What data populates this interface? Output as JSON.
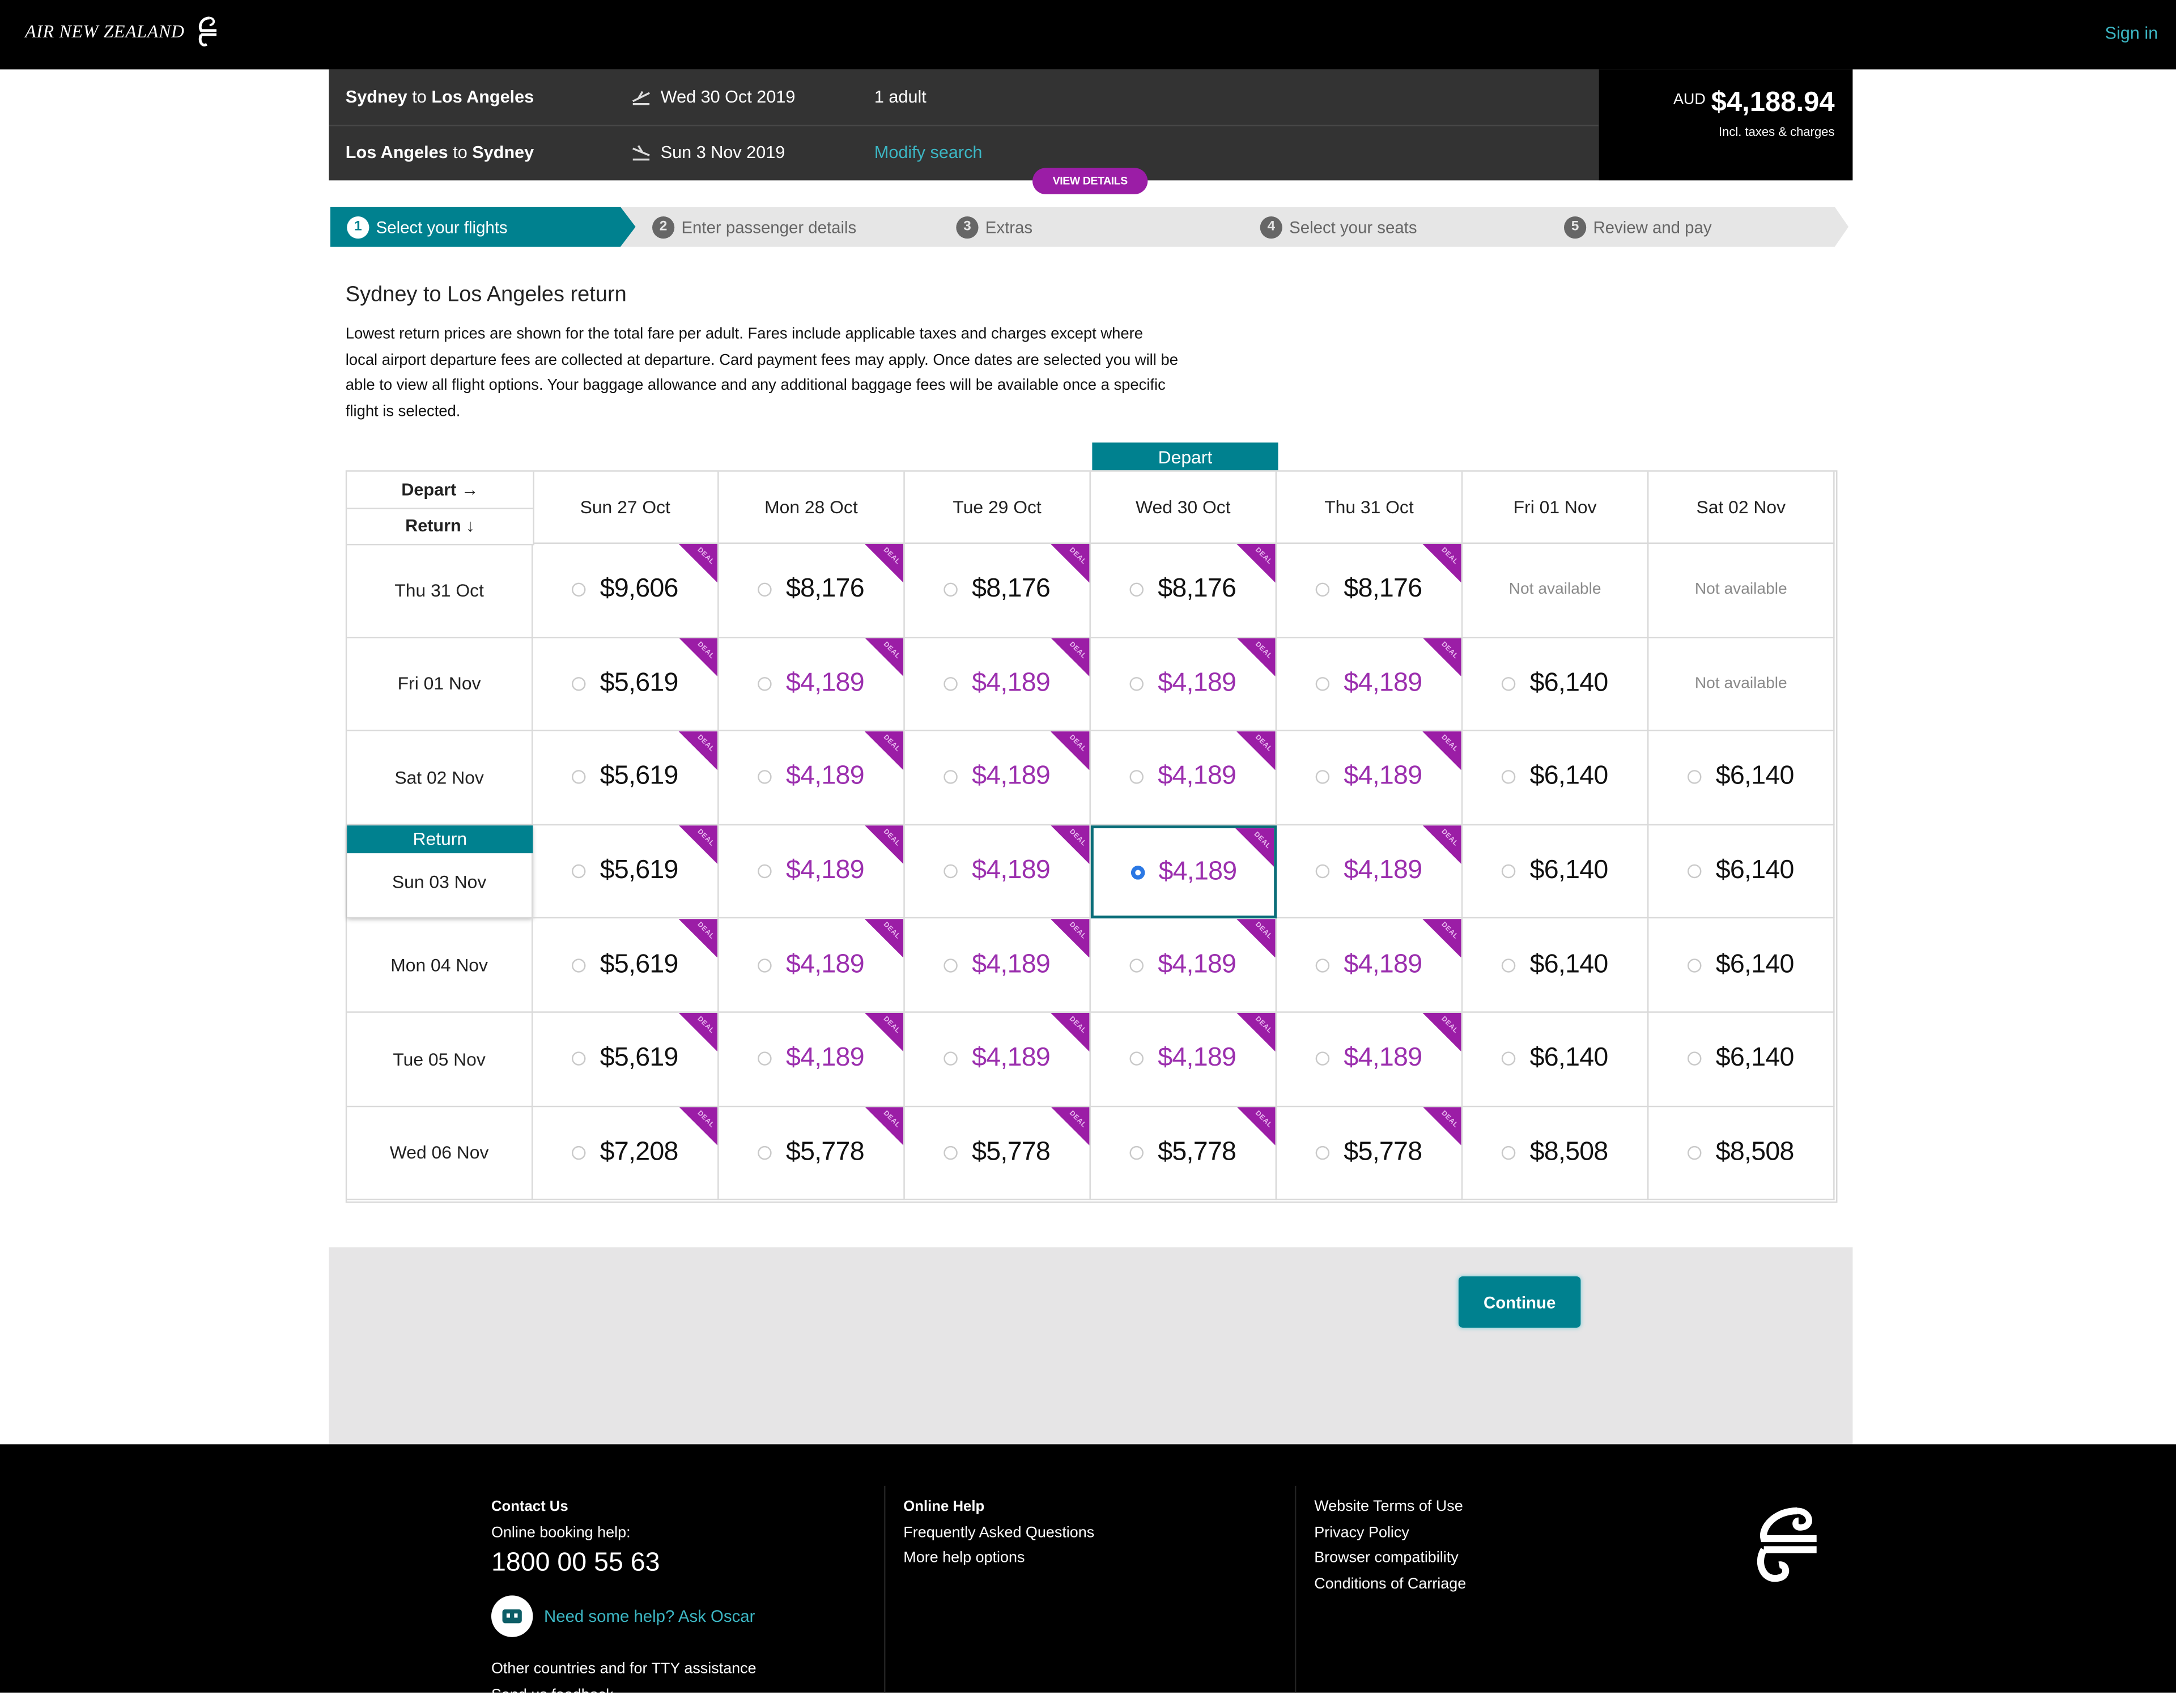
{
  "header": {
    "brand": "AIR NEW ZEALAND",
    "sign_in": "Sign in"
  },
  "summary": {
    "outbound": {
      "from": "Sydney",
      "to_word": "to",
      "to": "Los Angeles",
      "date": "Wed 30 Oct 2019",
      "icon": "plane-takeoff-icon"
    },
    "inbound": {
      "from": "Los Angeles",
      "to_word": "to",
      "to": "Sydney",
      "date": "Sun 3 Nov 2019",
      "icon": "plane-landing-icon"
    },
    "passengers": "1 adult",
    "modify_search": "Modify search",
    "view_details": "VIEW DETAILS",
    "currency": "AUD",
    "total": "$4,188.94",
    "total_note": "Incl. taxes & charges"
  },
  "steps": [
    {
      "num": "1",
      "label": "Select your flights",
      "active": true
    },
    {
      "num": "2",
      "label": "Enter passenger details",
      "active": false
    },
    {
      "num": "3",
      "label": "Extras",
      "active": false
    },
    {
      "num": "4",
      "label": "Select your seats",
      "active": false
    },
    {
      "num": "5",
      "label": "Review and pay",
      "active": false
    }
  ],
  "intro": {
    "title": "Sydney to Los Angeles return",
    "text": "Lowest return prices are shown for the total fare per adult. Fares include applicable taxes and charges except where local airport departure fees are collected at departure. Card payment fees may apply. Once dates are selected you will be able to view all flight options. Your baggage allowance and any additional baggage fees will be available once a specific flight is selected."
  },
  "grid": {
    "depart_label": "Depart →",
    "return_label": "Return ↓",
    "depart_flag": "Depart",
    "return_flag": "Return",
    "deal_label": "DEAL",
    "not_available": "Not available",
    "selected": {
      "depart_index": 3,
      "return_index": 3
    },
    "depart_dates": [
      "Sun 27 Oct",
      "Mon 28 Oct",
      "Tue 29 Oct",
      "Wed 30 Oct",
      "Thu 31 Oct",
      "Fri 01 Nov",
      "Sat 02 Nov"
    ],
    "rows": [
      {
        "return_date": "Thu 31 Oct",
        "cells": [
          {
            "price": "$9,606",
            "deal": true,
            "cheapest": false
          },
          {
            "price": "$8,176",
            "deal": true,
            "cheapest": false
          },
          {
            "price": "$8,176",
            "deal": true,
            "cheapest": false
          },
          {
            "price": "$8,176",
            "deal": true,
            "cheapest": false
          },
          {
            "price": "$8,176",
            "deal": true,
            "cheapest": false
          },
          {
            "price": null
          },
          {
            "price": null
          }
        ]
      },
      {
        "return_date": "Fri 01 Nov",
        "cells": [
          {
            "price": "$5,619",
            "deal": true,
            "cheapest": false
          },
          {
            "price": "$4,189",
            "deal": true,
            "cheapest": true
          },
          {
            "price": "$4,189",
            "deal": true,
            "cheapest": true
          },
          {
            "price": "$4,189",
            "deal": true,
            "cheapest": true
          },
          {
            "price": "$4,189",
            "deal": true,
            "cheapest": true
          },
          {
            "price": "$6,140",
            "deal": false,
            "cheapest": false
          },
          {
            "price": null
          }
        ]
      },
      {
        "return_date": "Sat 02 Nov",
        "cells": [
          {
            "price": "$5,619",
            "deal": true,
            "cheapest": false
          },
          {
            "price": "$4,189",
            "deal": true,
            "cheapest": true
          },
          {
            "price": "$4,189",
            "deal": true,
            "cheapest": true
          },
          {
            "price": "$4,189",
            "deal": true,
            "cheapest": true
          },
          {
            "price": "$4,189",
            "deal": true,
            "cheapest": true
          },
          {
            "price": "$6,140",
            "deal": false,
            "cheapest": false
          },
          {
            "price": "$6,140",
            "deal": false,
            "cheapest": false
          }
        ]
      },
      {
        "return_date": "Sun 03 Nov",
        "cells": [
          {
            "price": "$5,619",
            "deal": true,
            "cheapest": false
          },
          {
            "price": "$4,189",
            "deal": true,
            "cheapest": true
          },
          {
            "price": "$4,189",
            "deal": true,
            "cheapest": true
          },
          {
            "price": "$4,189",
            "deal": true,
            "cheapest": true
          },
          {
            "price": "$4,189",
            "deal": true,
            "cheapest": true
          },
          {
            "price": "$6,140",
            "deal": false,
            "cheapest": false
          },
          {
            "price": "$6,140",
            "deal": false,
            "cheapest": false
          }
        ]
      },
      {
        "return_date": "Mon 04 Nov",
        "cells": [
          {
            "price": "$5,619",
            "deal": true,
            "cheapest": false
          },
          {
            "price": "$4,189",
            "deal": true,
            "cheapest": true
          },
          {
            "price": "$4,189",
            "deal": true,
            "cheapest": true
          },
          {
            "price": "$4,189",
            "deal": true,
            "cheapest": true
          },
          {
            "price": "$4,189",
            "deal": true,
            "cheapest": true
          },
          {
            "price": "$6,140",
            "deal": false,
            "cheapest": false
          },
          {
            "price": "$6,140",
            "deal": false,
            "cheapest": false
          }
        ]
      },
      {
        "return_date": "Tue 05 Nov",
        "cells": [
          {
            "price": "$5,619",
            "deal": true,
            "cheapest": false
          },
          {
            "price": "$4,189",
            "deal": true,
            "cheapest": true
          },
          {
            "price": "$4,189",
            "deal": true,
            "cheapest": true
          },
          {
            "price": "$4,189",
            "deal": true,
            "cheapest": true
          },
          {
            "price": "$4,189",
            "deal": true,
            "cheapest": true
          },
          {
            "price": "$6,140",
            "deal": false,
            "cheapest": false
          },
          {
            "price": "$6,140",
            "deal": false,
            "cheapest": false
          }
        ]
      },
      {
        "return_date": "Wed 06 Nov",
        "cells": [
          {
            "price": "$7,208",
            "deal": true,
            "cheapest": false
          },
          {
            "price": "$5,778",
            "deal": true,
            "cheapest": false
          },
          {
            "price": "$5,778",
            "deal": true,
            "cheapest": false
          },
          {
            "price": "$5,778",
            "deal": true,
            "cheapest": false
          },
          {
            "price": "$5,778",
            "deal": true,
            "cheapest": false
          },
          {
            "price": "$8,508",
            "deal": false,
            "cheapest": false
          },
          {
            "price": "$8,508",
            "deal": false,
            "cheapest": false
          }
        ]
      }
    ]
  },
  "actions": {
    "continue": "Continue"
  },
  "footer": {
    "contact": {
      "heading": "Contact Us",
      "booking_help": "Online booking help:",
      "phone": "1800 00 55 63",
      "oscar": "Need some help? Ask Oscar",
      "tty": "Other countries and for TTY assistance",
      "feedback": "Send us feedback"
    },
    "help": {
      "heading": "Online Help",
      "links": [
        "Frequently Asked Questions",
        "More help options"
      ]
    },
    "legal": {
      "links": [
        "Website Terms of Use",
        "Privacy Policy",
        "Browser compatibility",
        "Conditions of Carriage"
      ]
    }
  },
  "colors": {
    "teal": "#00818f",
    "deal_purple": "#9b1da6",
    "link_teal": "#3cb6c3",
    "selected_radio": "#2b78e4"
  }
}
